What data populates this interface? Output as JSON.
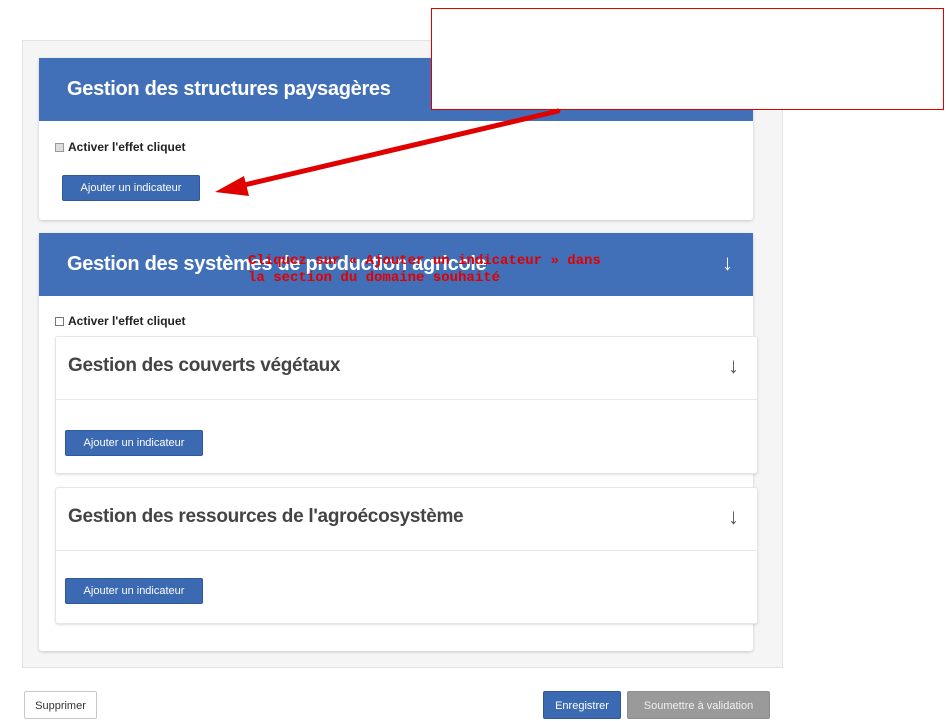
{
  "sections": [
    {
      "title": "Gestion des structures paysagères",
      "checkbox_label": "Activer l'effet cliquet",
      "add_button": "Ajouter un indicateur"
    },
    {
      "title": "Gestion des systèmes de production agricole",
      "arrow": "↓",
      "checkbox_label": "Activer l'effet cliquet",
      "subsections": [
        {
          "title": "Gestion des couverts végétaux",
          "arrow": "↓",
          "add_button": "Ajouter un indicateur"
        },
        {
          "title": "Gestion des ressources de l'agroécosystème",
          "arrow": "↓",
          "add_button": "Ajouter un indicateur"
        }
      ]
    }
  ],
  "footer": {
    "delete_label": "Supprimer",
    "save_label": "Enregistrer",
    "submit_label": "Soumettre à validation"
  },
  "annotation": {
    "text": "Cliquez sur « Ajouter un indicateur » dans la section du domaine souhaité",
    "color": "#e00000"
  },
  "colors": {
    "header_blue": "#4270b8",
    "button_blue": "#3b69b2",
    "disabled_gray": "#9a9a9a"
  }
}
